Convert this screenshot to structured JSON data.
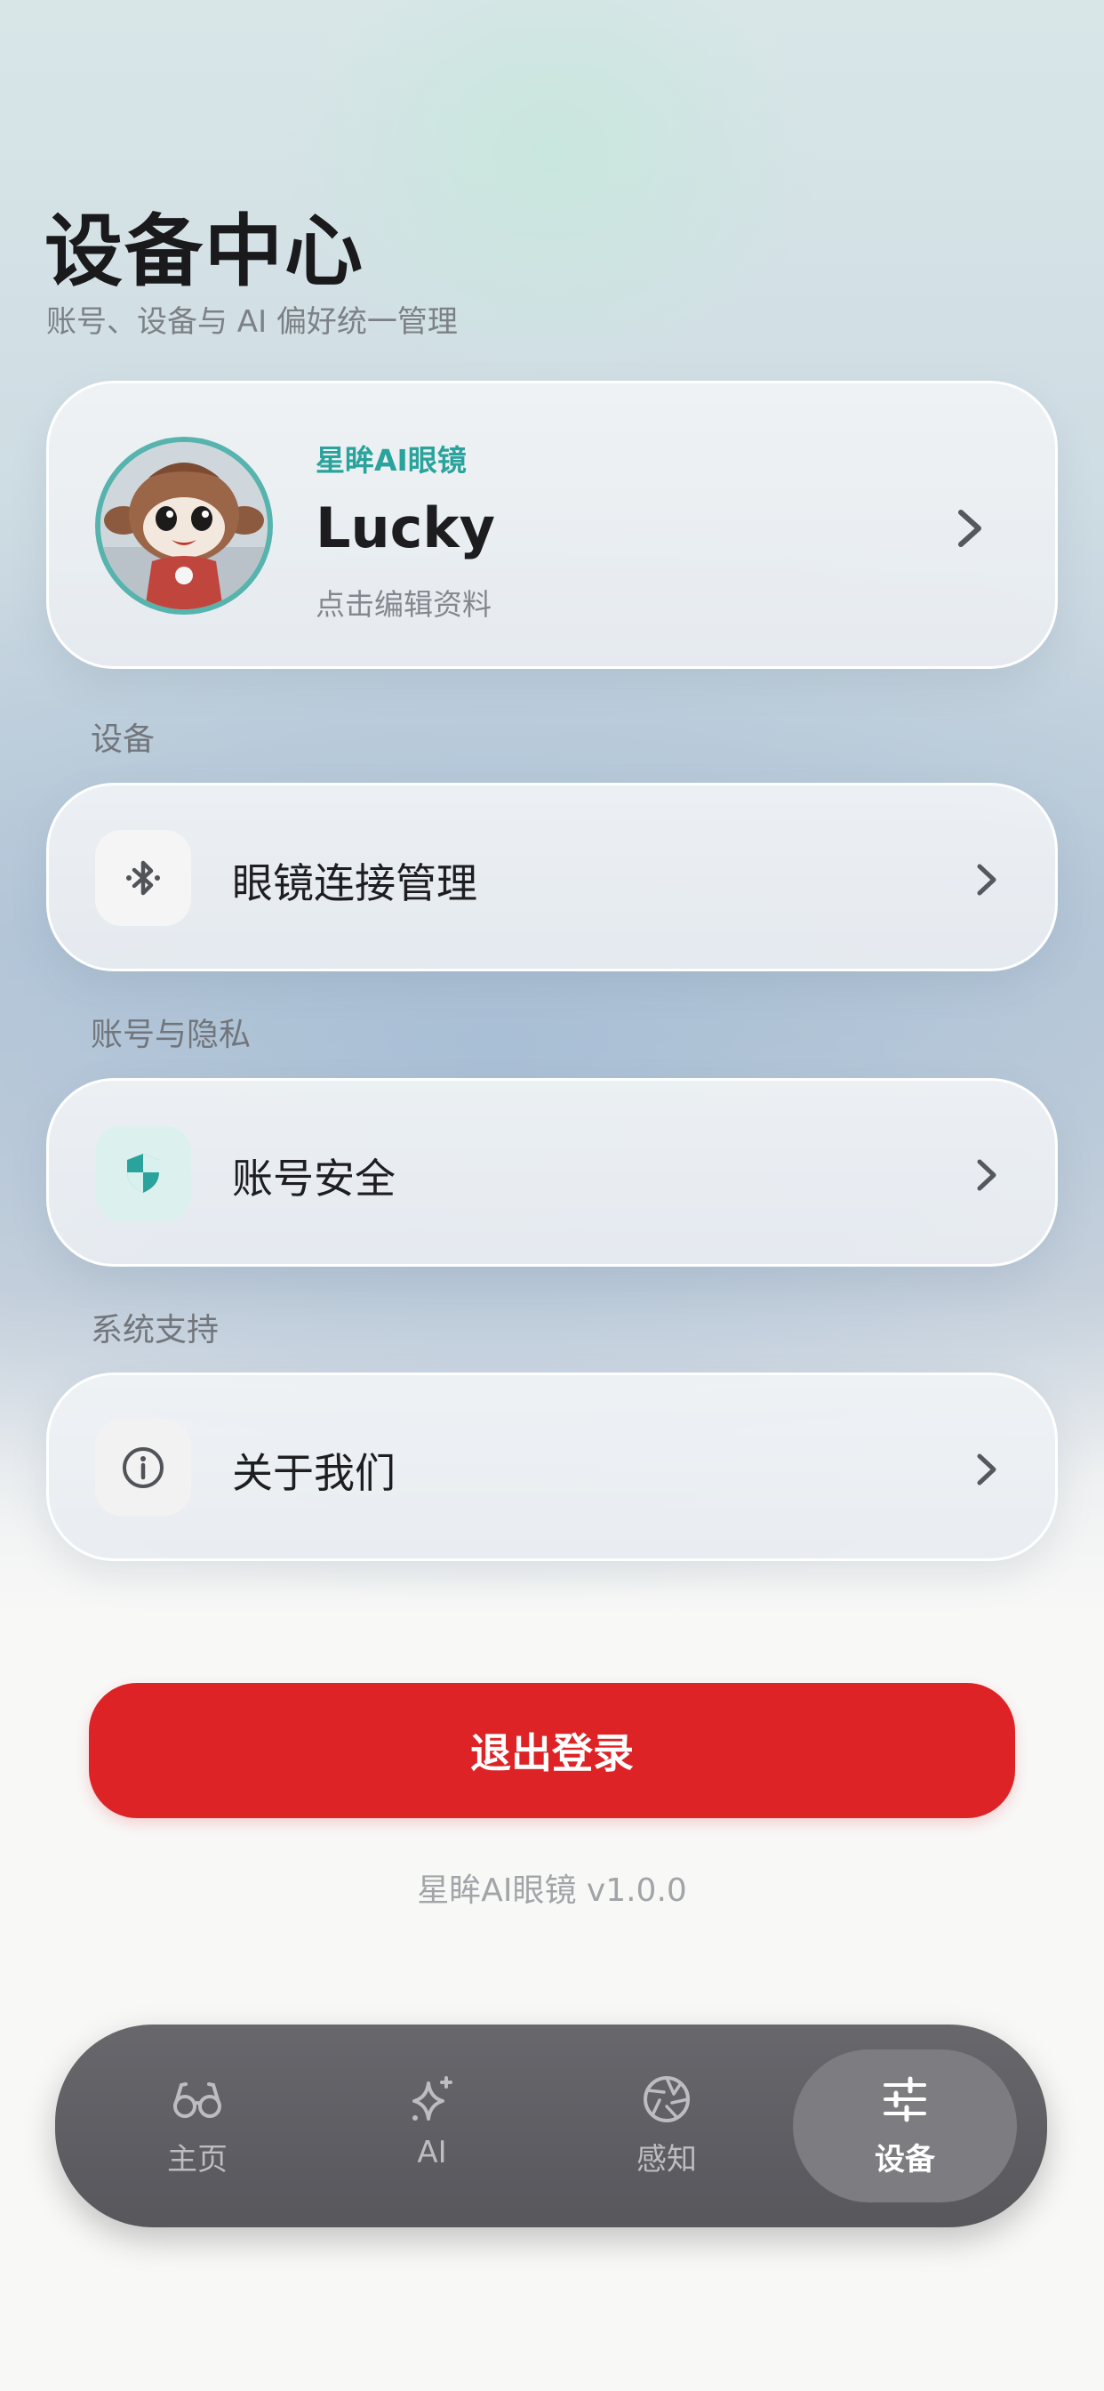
{
  "header": {
    "title": "设备中心",
    "subtitle": "账号、设备与 AI 偏好统一管理"
  },
  "profile": {
    "brand": "星眸AI眼镜",
    "name": "Lucky",
    "hint": "点击编辑资料"
  },
  "sections": {
    "device": {
      "label": "设备",
      "item": "眼镜连接管理"
    },
    "account": {
      "label": "账号与隐私",
      "item": "账号安全"
    },
    "support": {
      "label": "系统支持",
      "item": "关于我们"
    }
  },
  "logout_label": "退出登录",
  "version": "星眸AI眼镜 v1.0.0",
  "tabs": [
    {
      "label": "主页",
      "icon": "glasses-icon"
    },
    {
      "label": "AI",
      "icon": "sparkle-icon"
    },
    {
      "label": "感知",
      "icon": "aperture-icon"
    },
    {
      "label": "设备",
      "icon": "sliders-icon",
      "active": true
    }
  ],
  "colors": {
    "accent": "#2aa39c",
    "danger": "#dd2326",
    "tabbar": "#5f5f64"
  }
}
